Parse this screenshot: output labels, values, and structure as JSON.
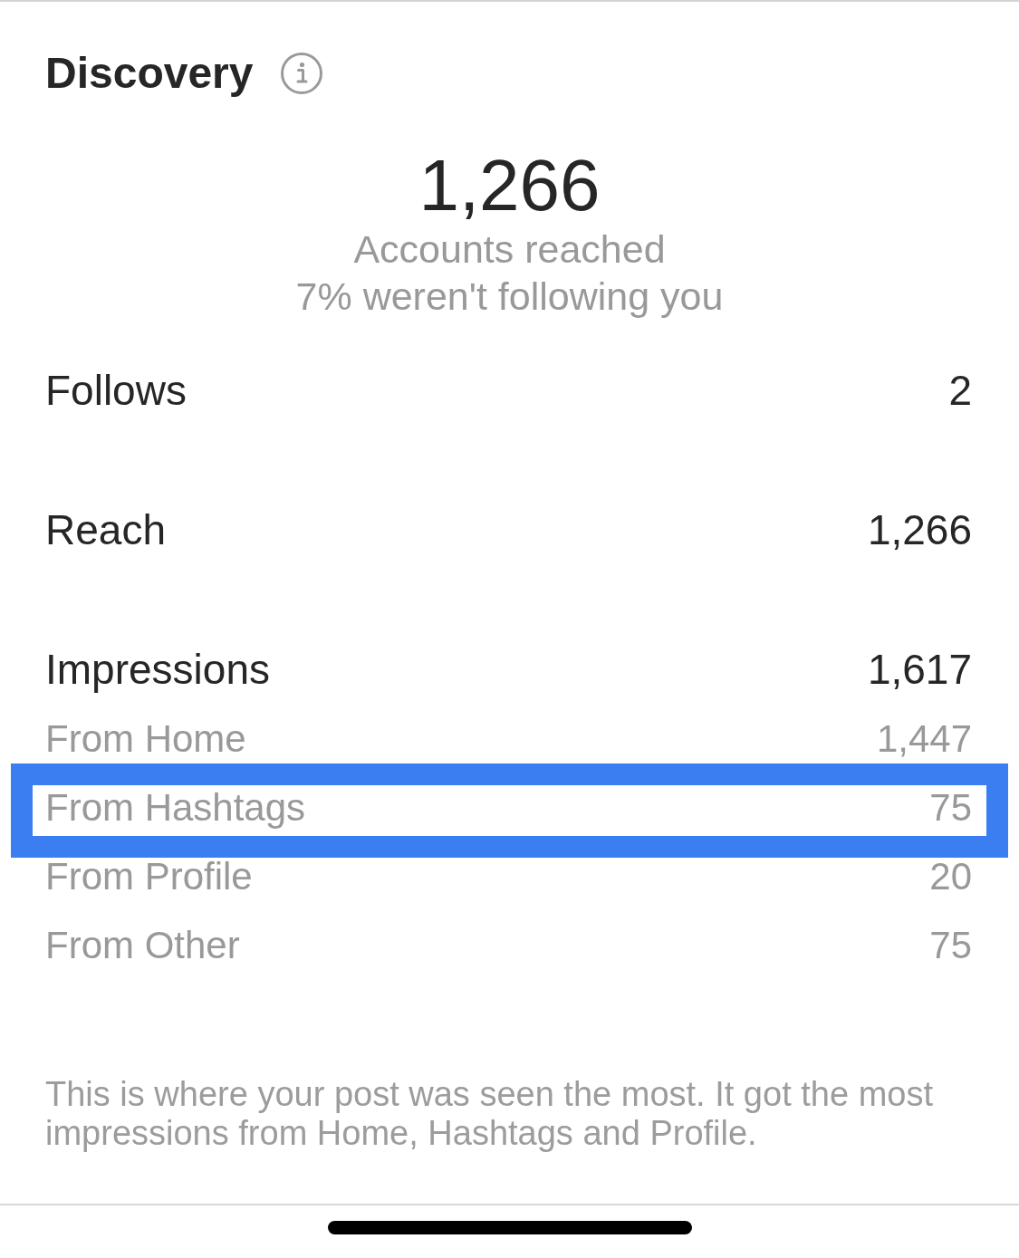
{
  "header": {
    "title": "Discovery"
  },
  "summary": {
    "value": "1,266",
    "label": "Accounts reached",
    "note": "7% weren't following you"
  },
  "metrics": [
    {
      "label": "Follows",
      "value": "2"
    },
    {
      "label": "Reach",
      "value": "1,266"
    },
    {
      "label": "Impressions",
      "value": "1,617",
      "sources": [
        {
          "label": "From Home",
          "value": "1,447",
          "highlighted": false
        },
        {
          "label": "From Hashtags",
          "value": "75",
          "highlighted": true
        },
        {
          "label": "From Profile",
          "value": "20",
          "highlighted": false
        },
        {
          "label": "From Other",
          "value": "75",
          "highlighted": false
        }
      ]
    }
  ],
  "footnote": "This is where your post was seen the most. It got the most impressions from Home, Hashtags and Profile."
}
